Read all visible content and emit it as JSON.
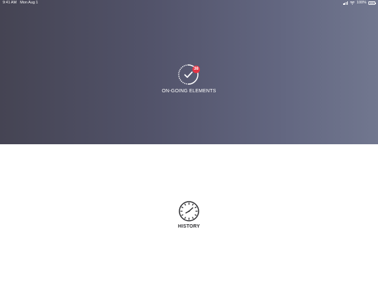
{
  "status_bar": {
    "time": "9:41 AM",
    "date": "Mon Aug 1",
    "battery": "100%"
  },
  "ongoing": {
    "label": "ON-GOING ELEMENTS",
    "badge_count": "38",
    "icon": "checklist-progress-icon",
    "badge_color": "#e63545"
  },
  "history": {
    "label": "HISTORY",
    "icon": "clock-icon"
  },
  "colors": {
    "gradient_start": "#454453",
    "gradient_end": "#71778f",
    "text_light": "#ffffff",
    "text_dark": "#2a2a2e"
  }
}
